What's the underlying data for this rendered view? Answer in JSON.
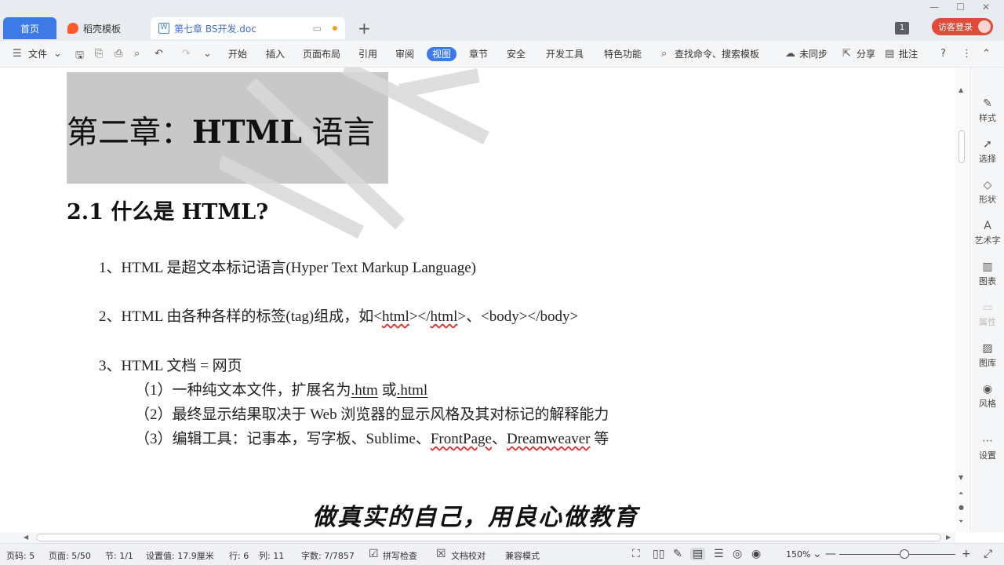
{
  "tabs": {
    "home": "首页",
    "docer": "稻壳模板",
    "document": "第七章 BS开发.doc",
    "new_tab": "+"
  },
  "window": {
    "badge": "1",
    "login": "访客登录"
  },
  "menubar": {
    "file": "文件",
    "items": [
      "开始",
      "插入",
      "页面布局",
      "引用",
      "审阅",
      "视图",
      "章节",
      "安全",
      "开发工具",
      "特色功能"
    ],
    "search": "查找命令、搜索模板",
    "sync": "未同步",
    "share": "分享",
    "comment": "批注"
  },
  "document": {
    "chapter_title_cn": "第二章：",
    "chapter_title_en": "HTML",
    "chapter_title_tail": " 语言",
    "section_title": "2.1 什么是 HTML?",
    "line1": "1、HTML 是超文本标记语言(Hyper Text Markup Language)",
    "line2_pre": "2、HTML 由各种各样的标签(tag)组成，如<",
    "line2_html1": "html",
    "line2_mid": "></",
    "line2_html2": "html",
    "line2_post": ">、<body></body>",
    "line3": "3、HTML 文档  =  网页",
    "sub1_pre": "（1）一种纯文本文件，扩展名为",
    "sub1_ext1": ".htm",
    "sub1_mid": " 或",
    "sub1_ext2": ".html",
    "sub2": "（2）最终显示结果取决于 Web 浏览器的显示风格及其对标记的解释能力",
    "sub3_pre": "（3）编辑工具：记事本，写字板、Sublime、",
    "sub3_fp": "FrontPage",
    "sub3_sep": "、",
    "sub3_dw": "Dreamweaver",
    "sub3_post": " 等",
    "slogan": "做真实的自己，用良心做教育"
  },
  "right_panel": {
    "style": "样式",
    "select": "选择",
    "shape": "形状",
    "wordart": "艺术字",
    "chart": "图表",
    "property": "属性",
    "gallery": "图库",
    "theme": "风格",
    "settings": "设置"
  },
  "status": {
    "page_code": "页码: 5",
    "page": "页面: 5/50",
    "section": "节: 1/1",
    "setting": "设置值: 17.9厘米",
    "row": "行: 6",
    "col": "列: 11",
    "words": "字数: 7/7857",
    "spell": "拼写检查",
    "proof": "文档校对",
    "compat": "兼容模式",
    "zoom": "150%"
  },
  "colors": {
    "accent": "#3d7ae8",
    "login_red": "#e04b3a",
    "heading_highlight": "#c8c8c8"
  }
}
